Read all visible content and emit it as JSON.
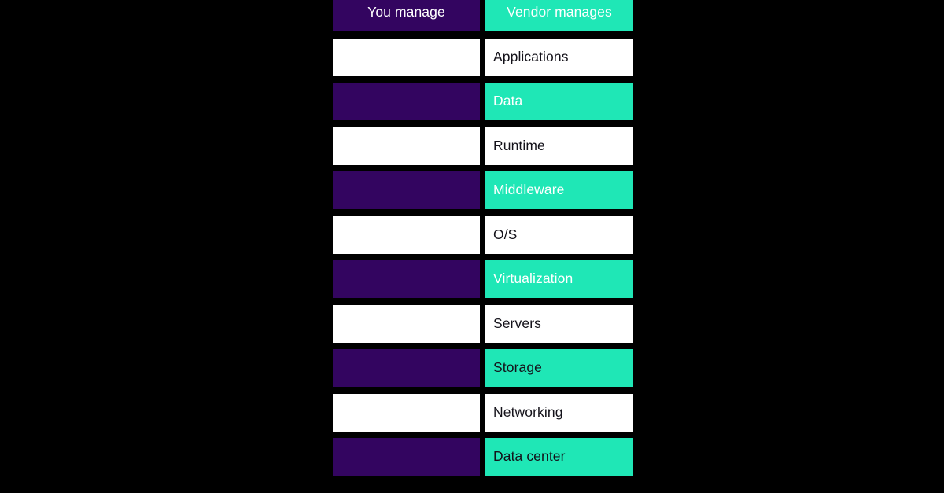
{
  "diagram": {
    "type": "responsibility-matrix",
    "background_color": "#000000",
    "colors": {
      "purple": "#330560",
      "teal": "#1FE7B6",
      "white": "#FFFFFF",
      "text_dark": "#14121A",
      "text_light": "#FFFFFF"
    },
    "columns": [
      {
        "key": "you",
        "label": "You manage",
        "header_fill": "purple",
        "header_text_color": "light"
      },
      {
        "key": "vendor",
        "label": "Vendor manages",
        "header_fill": "teal",
        "header_text_color": "light"
      }
    ],
    "rows": [
      {
        "layer": "Applications",
        "left": {
          "fill": "white",
          "label": "",
          "text_color": "none"
        },
        "right": {
          "fill": "white",
          "label": "Applications",
          "text_color": "dark"
        }
      },
      {
        "layer": "Data",
        "left": {
          "fill": "purple",
          "label": "",
          "text_color": "none"
        },
        "right": {
          "fill": "teal",
          "label": "Data",
          "text_color": "light"
        }
      },
      {
        "layer": "Runtime",
        "left": {
          "fill": "white",
          "label": "",
          "text_color": "none"
        },
        "right": {
          "fill": "white",
          "label": "Runtime",
          "text_color": "dark"
        }
      },
      {
        "layer": "Middleware",
        "left": {
          "fill": "purple",
          "label": "",
          "text_color": "none"
        },
        "right": {
          "fill": "teal",
          "label": "Middleware",
          "text_color": "light"
        }
      },
      {
        "layer": "O/S",
        "left": {
          "fill": "white",
          "label": "",
          "text_color": "none"
        },
        "right": {
          "fill": "white",
          "label": "O/S",
          "text_color": "dark"
        }
      },
      {
        "layer": "Virtualization",
        "left": {
          "fill": "purple",
          "label": "",
          "text_color": "none"
        },
        "right": {
          "fill": "teal",
          "label": "Virtualization",
          "text_color": "light"
        }
      },
      {
        "layer": "Servers",
        "left": {
          "fill": "white",
          "label": "",
          "text_color": "none"
        },
        "right": {
          "fill": "white",
          "label": "Servers",
          "text_color": "dark"
        }
      },
      {
        "layer": "Storage",
        "left": {
          "fill": "purple",
          "label": "",
          "text_color": "none"
        },
        "right": {
          "fill": "teal",
          "label": "Storage",
          "text_color": "dark"
        }
      },
      {
        "layer": "Networking",
        "left": {
          "fill": "white",
          "label": "",
          "text_color": "none"
        },
        "right": {
          "fill": "white",
          "label": "Networking",
          "text_color": "dark"
        }
      },
      {
        "layer": "Data center",
        "left": {
          "fill": "purple",
          "label": "",
          "text_color": "none"
        },
        "right": {
          "fill": "teal",
          "label": "Data center",
          "text_color": "dark"
        }
      }
    ]
  }
}
